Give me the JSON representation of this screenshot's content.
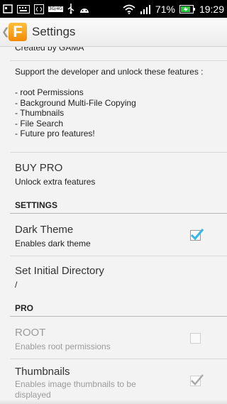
{
  "status_bar": {
    "icons": [
      "notification-icon",
      "keyboard-icon",
      "code-icon",
      "data-3g-4g-icon",
      "usb-icon",
      "android-icon",
      "wifi-icon",
      "signal-icon",
      "battery-charging-icon"
    ],
    "network_tag": "3G/4G",
    "battery_percent": "71%",
    "time": "19:29"
  },
  "action_bar": {
    "up_glyph": "❮",
    "app_icon_letter": "F",
    "title": "Settings"
  },
  "content": {
    "created_by": "Created by GAMA",
    "support_text": "Support the developer and unlock these features :\n\n- root Permissions\n- Background Multi-File Copying\n- Thumbnails\n- File Search\n- Future pro features!",
    "buy_pro": {
      "title": "BUY PRO",
      "summary": "Unlock extra features"
    },
    "settings_header": "SETTINGS",
    "dark_theme": {
      "title": "Dark Theme",
      "summary": "Enables dark theme",
      "checked": true
    },
    "initial_dir": {
      "title": "Set Initial Directory",
      "summary": "/"
    },
    "pro_header": "PRO",
    "root": {
      "title": "ROOT",
      "summary": "Enables root permissions",
      "checked": false,
      "enabled": false
    },
    "thumbnails": {
      "title": "Thumbnails",
      "summary": "Enables image thumbnails to be displayed",
      "checked": true,
      "enabled": false
    }
  },
  "colors": {
    "accent": "#33b5e5",
    "app_icon": "#f5a623",
    "disabled_text": "#9b9b9b"
  }
}
